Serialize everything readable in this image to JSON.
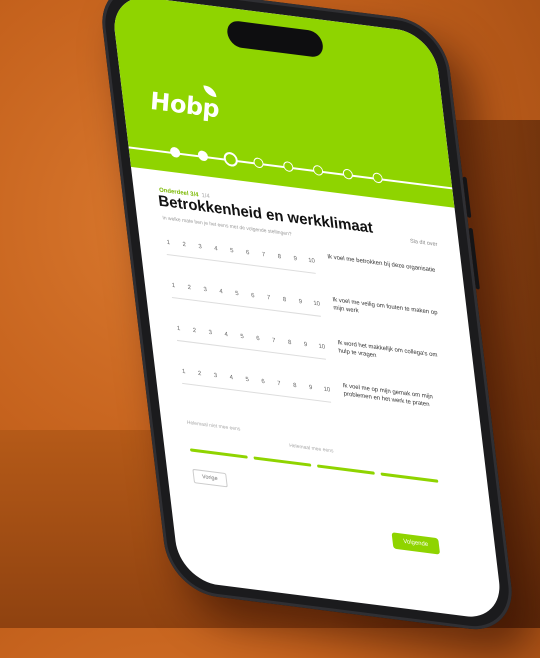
{
  "app": {
    "brand": "Hobp"
  },
  "progress": {
    "total_steps": 8,
    "current_step": 3
  },
  "survey": {
    "crumb_active": "Onderdeel 3/4",
    "crumb_rest": "1/4",
    "title": "Betrokkenheid en werkklimaat",
    "subtitle": "In welke mate ben je het eens met de volgende stellingen?",
    "skip_label": "Sla dit over",
    "scale": [
      "1",
      "2",
      "3",
      "4",
      "5",
      "6",
      "7",
      "8",
      "9",
      "10"
    ],
    "questions": [
      "Ik voel me betrokken bij deze organisatie",
      "Ik voel me veilig om fouten te maken op mijn werk",
      "Ik word het makkelijk om collega's om hulp te vragen",
      "Ik voel me op mijn gemak om mijn problemen en het werk te praten"
    ],
    "meta_left": "Helemaal niet mee eens",
    "meta_right": "Helemaal mee eens"
  },
  "nav": {
    "prev_label": "Vorige",
    "next_label": "Volgende"
  },
  "colors": {
    "accent": "#8fd400",
    "background": "#c5621d"
  }
}
